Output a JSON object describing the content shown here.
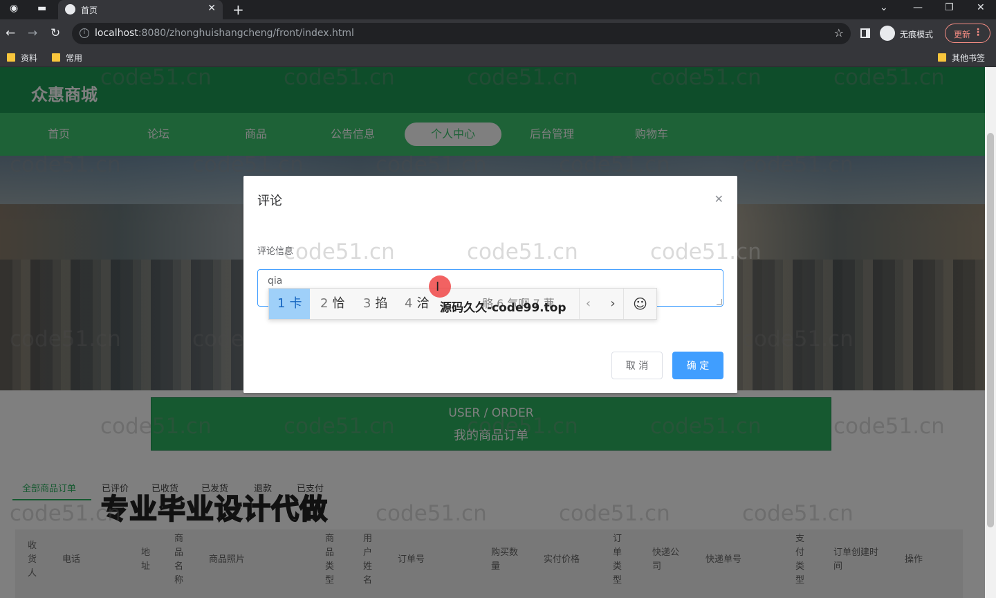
{
  "browser": {
    "tab_title": "首页",
    "url_host": "localhost",
    "url_path": ":8080/zhonghuishangcheng/front/index.html",
    "incognito_label": "无痕模式",
    "update_label": "更新",
    "bookmarks": [
      "资料",
      "常用"
    ],
    "other_bookmarks": "其他书签"
  },
  "site": {
    "title": "众惠商城",
    "nav": [
      "首页",
      "论坛",
      "商品",
      "公告信息",
      "个人中心",
      "后台管理",
      "购物车"
    ],
    "active_nav": "个人中心",
    "order_banner_en": "USER / ORDER",
    "order_banner_cn": "我的商品订单",
    "order_tabs": [
      "全部商品订单",
      "已评价",
      "已收货",
      "已发货",
      "退款",
      "已支付"
    ],
    "promo_overlay": "专业毕业设计代做",
    "table_headers": [
      "收货人",
      "电话",
      "地址",
      "商品名称",
      "商品照片",
      "商品类型",
      "用户姓名",
      "订单号",
      "购买数量",
      "实付价格",
      "订单类型",
      "快递公司",
      "快递单号",
      "支付类型",
      "订单创建时间",
      "操作"
    ]
  },
  "dialog": {
    "title": "评论",
    "field_label": "评论信息",
    "input_value": "qia",
    "cancel_label": "取 消",
    "ok_label": "确 定"
  },
  "ime": {
    "candidates": [
      {
        "num": "1",
        "text": "卡"
      },
      {
        "num": "2",
        "text": "恰"
      },
      {
        "num": "3",
        "text": "掐"
      },
      {
        "num": "4",
        "text": "洽"
      }
    ],
    "overlay_text": "源码久久-code99.top",
    "faded_candidates": "骼 6 气啊 7 茀"
  },
  "watermark_text": "code51.cn"
}
